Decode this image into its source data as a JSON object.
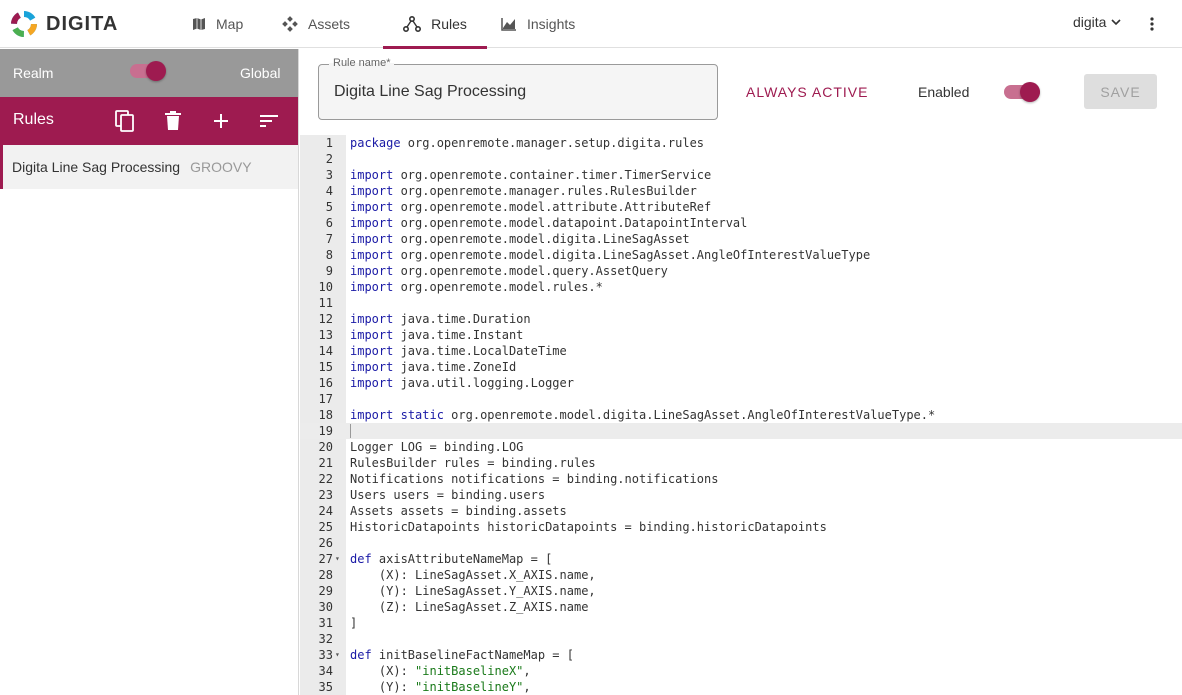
{
  "app": {
    "logo_text": "DIGITA"
  },
  "nav": [
    {
      "label": "Map",
      "icon": "map-icon"
    },
    {
      "label": "Assets",
      "icon": "assets-icon"
    },
    {
      "label": "Rules",
      "icon": "rules-icon",
      "active": true
    },
    {
      "label": "Insights",
      "icon": "insights-icon"
    }
  ],
  "user": {
    "name": "digita"
  },
  "sidebar": {
    "realm_label": "Realm",
    "global_label": "Global",
    "rules_title": "Rules",
    "rules": [
      {
        "name": "Digita Line Sag Processing",
        "lang": "GROOVY"
      }
    ]
  },
  "form": {
    "name_label": "Rule name*",
    "name_value": "Digita Line Sag Processing",
    "always_active": "ALWAYS ACTIVE",
    "enabled_label": "Enabled",
    "save_label": "SAVE"
  },
  "colors": {
    "accent": "#9e1b50",
    "realm_bar": "#999999"
  },
  "editor": {
    "active_line": 19,
    "lines": [
      "package org.openremote.manager.setup.digita.rules",
      "",
      "import org.openremote.container.timer.TimerService",
      "import org.openremote.manager.rules.RulesBuilder",
      "import org.openremote.model.attribute.AttributeRef",
      "import org.openremote.model.datapoint.DatapointInterval",
      "import org.openremote.model.digita.LineSagAsset",
      "import org.openremote.model.digita.LineSagAsset.AngleOfInterestValueType",
      "import org.openremote.model.query.AssetQuery",
      "import org.openremote.model.rules.*",
      "",
      "import java.time.Duration",
      "import java.time.Instant",
      "import java.time.LocalDateTime",
      "import java.time.ZoneId",
      "import java.util.logging.Logger",
      "",
      "import static org.openremote.model.digita.LineSagAsset.AngleOfInterestValueType.*",
      "",
      "Logger LOG = binding.LOG",
      "RulesBuilder rules = binding.rules",
      "Notifications notifications = binding.notifications",
      "Users users = binding.users",
      "Assets assets = binding.assets",
      "HistoricDatapoints historicDatapoints = binding.historicDatapoints",
      "",
      "def axisAttributeNameMap = [",
      "    (X): LineSagAsset.X_AXIS.name,",
      "    (Y): LineSagAsset.Y_AXIS.name,",
      "    (Z): LineSagAsset.Z_AXIS.name",
      "]",
      "",
      "def initBaselineFactNameMap = [",
      "    (X): \"initBaselineX\",",
      "    (Y): \"initBaselineY\","
    ],
    "fold_lines": [
      27,
      33
    ]
  }
}
